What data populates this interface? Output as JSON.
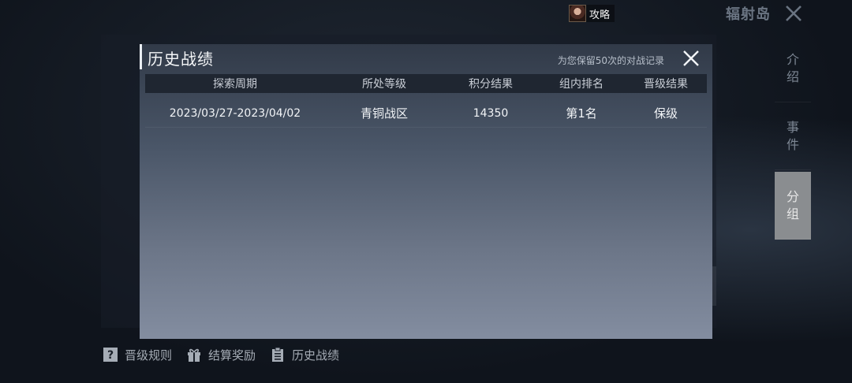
{
  "topbar": {
    "guide_label": "攻略",
    "region_title": "辐射岛",
    "close_icon": "close-icon"
  },
  "side_tabs": [
    {
      "label_1": "介",
      "label_2": "绍",
      "active": false
    },
    {
      "label_1": "事",
      "label_2": "件",
      "active": false
    },
    {
      "label_1": "分",
      "label_2": "组",
      "active": true
    }
  ],
  "bottom_bar": {
    "rules_label": "晋级规则",
    "rewards_label": "结算奖励",
    "history_label": "历史战绩"
  },
  "dialog": {
    "title": "历史战绩",
    "note": "为您保留50次的对战记录",
    "columns": [
      "探索周期",
      "所处等级",
      "积分结果",
      "组内排名",
      "晋级结果"
    ],
    "rows": [
      {
        "period": "2023/03/27-2023/04/02",
        "tier": "青铜战区",
        "score": "14350",
        "rank": "第1名",
        "result": "保级"
      }
    ]
  },
  "colors": {
    "dialog_top": "#313a48",
    "dialog_bottom": "#838da0",
    "header_bg": "#1f2631",
    "active_tab": "#8a8d90"
  }
}
